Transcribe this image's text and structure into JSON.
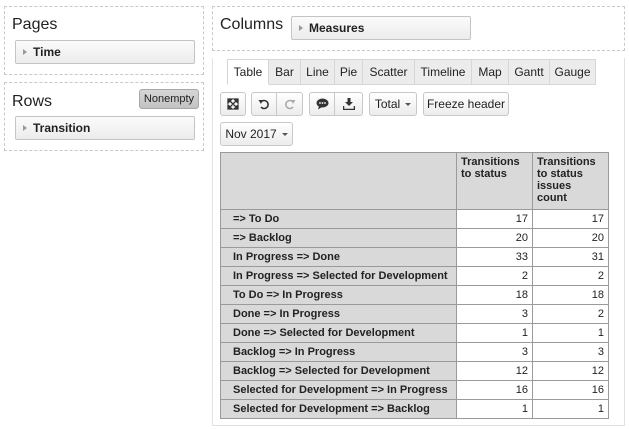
{
  "pages": {
    "title": "Pages",
    "items": [
      "Time"
    ]
  },
  "rows": {
    "title": "Rows",
    "nonempty_label": "Nonempty",
    "items": [
      "Transition"
    ]
  },
  "columns": {
    "title": "Columns",
    "items": [
      "Measures"
    ]
  },
  "tabs": [
    "Table",
    "Bar",
    "Line",
    "Pie",
    "Scatter",
    "Timeline",
    "Map",
    "Gantt",
    "Gauge"
  ],
  "active_tab": "Table",
  "toolbar": {
    "total_label": "Total",
    "freeze_label": "Freeze header"
  },
  "page_filter": {
    "value": "Nov 2017"
  },
  "table": {
    "columns": [
      "Transitions to status",
      "Transitions to status issues count"
    ],
    "rows": [
      {
        "label": "=> To Do",
        "values": [
          17,
          17
        ]
      },
      {
        "label": "=> Backlog",
        "values": [
          20,
          20
        ]
      },
      {
        "label": "In Progress => Done",
        "values": [
          33,
          31
        ]
      },
      {
        "label": "In Progress => Selected for Development",
        "values": [
          2,
          2
        ]
      },
      {
        "label": "To Do => In Progress",
        "values": [
          18,
          18
        ]
      },
      {
        "label": "Done => In Progress",
        "values": [
          3,
          2
        ]
      },
      {
        "label": "Done => Selected for Development",
        "values": [
          1,
          1
        ]
      },
      {
        "label": "Backlog => In Progress",
        "values": [
          3,
          3
        ]
      },
      {
        "label": "Backlog => Selected for Development",
        "values": [
          12,
          12
        ]
      },
      {
        "label": "Selected for Development => In Progress",
        "values": [
          16,
          16
        ]
      },
      {
        "label": "Selected for Development => Backlog",
        "values": [
          1,
          1
        ]
      }
    ]
  }
}
